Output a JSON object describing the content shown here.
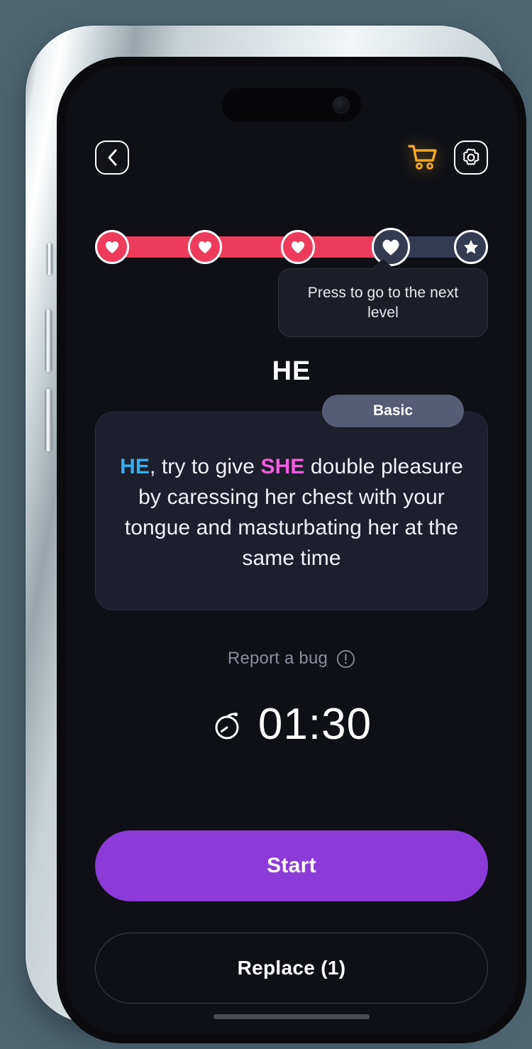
{
  "theme": {
    "page_background": "#4d6672",
    "screen_background": "#0e1016",
    "accent_purple": "#8c3ad8",
    "accent_red": "#ee3b5b",
    "track_inactive": "#343a52",
    "card_background": "#1d1f2d",
    "badge_background": "#565b76",
    "cart_orange": "#f5a623",
    "he_color": "#35aeef",
    "she_color": "#f45ddf",
    "muted_text": "#8b8e9c"
  },
  "topbar": {
    "back_icon": "chevron-left-icon",
    "cart_icon": "shopping-cart-icon",
    "settings_icon": "gear-icon"
  },
  "progress": {
    "total_levels": 5,
    "completed": 3,
    "current_index": 3,
    "fill_percent": 75,
    "nodes": [
      {
        "icon": "heart-icon",
        "state": "done"
      },
      {
        "icon": "heart-icon",
        "state": "done"
      },
      {
        "icon": "heart-icon",
        "state": "done"
      },
      {
        "icon": "heart-icon",
        "state": "current"
      },
      {
        "icon": "star-icon",
        "state": "locked"
      }
    ]
  },
  "tooltip": {
    "text": "Press to go to the next level"
  },
  "content": {
    "role_title": "HE",
    "difficulty_badge": "Basic",
    "task": {
      "prefix_role": "HE",
      "middle": ", try to give ",
      "target_role": "SHE",
      "suffix": " double pleasure by caressing her chest with your tongue and masturbating her at the same time"
    }
  },
  "report": {
    "label": "Report a bug",
    "icon": "exclamation-circle-icon"
  },
  "timer": {
    "icon": "stopwatch-icon",
    "value": "01:30"
  },
  "actions": {
    "start_label": "Start",
    "replace_label": "Replace (1)"
  }
}
